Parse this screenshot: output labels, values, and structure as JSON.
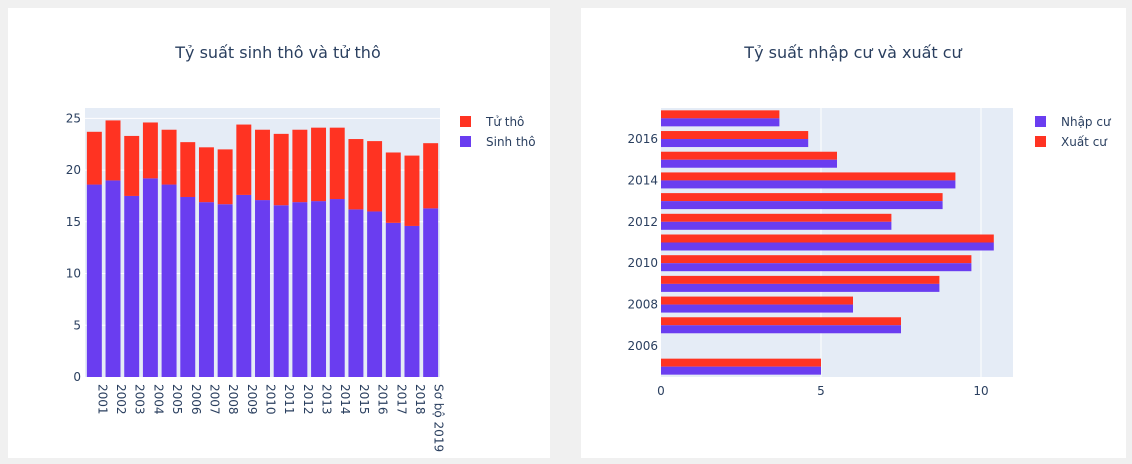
{
  "chart_data": [
    {
      "type": "bar",
      "orientation": "vertical",
      "stacked": true,
      "title": "Tỷ suất sinh thô và tử thô",
      "xlabel": "",
      "ylabel": "",
      "categories": [
        "2001",
        "2002",
        "2003",
        "2004",
        "2005",
        "2006",
        "2007",
        "2008",
        "2009",
        "2010",
        "2011",
        "2012",
        "2013",
        "2014",
        "2015",
        "2016",
        "2017",
        "2018",
        "Sơ bộ 2019"
      ],
      "series": [
        {
          "name": "Sinh thô",
          "color": "#6a3df0",
          "values": [
            18.6,
            19.0,
            17.5,
            19.2,
            18.6,
            17.4,
            16.9,
            16.7,
            17.6,
            17.1,
            16.6,
            16.9,
            17.0,
            17.2,
            16.2,
            16.0,
            14.9,
            14.6,
            16.3
          ]
        },
        {
          "name": "Tử thô",
          "color": "#ff3322",
          "values": [
            5.1,
            5.8,
            5.8,
            5.4,
            5.3,
            5.3,
            5.3,
            5.3,
            6.8,
            6.8,
            6.9,
            7.0,
            7.1,
            6.9,
            6.8,
            6.8,
            6.8,
            6.8,
            6.3
          ]
        }
      ],
      "ylim": [
        0,
        26
      ],
      "yticks": [
        0,
        5,
        10,
        15,
        20,
        25
      ],
      "grid": true,
      "legend": [
        "Tử thô",
        "Sinh thô"
      ],
      "legend_position": "right"
    },
    {
      "type": "bar",
      "orientation": "horizontal",
      "stacked": false,
      "title": "Tỷ suất nhập cư và xuất cư",
      "xlabel": "",
      "ylabel": "",
      "categories": [
        "2005",
        "2006",
        "2007",
        "2008",
        "2009",
        "2010",
        "2011",
        "2012",
        "2013",
        "2014",
        "2015",
        "2016",
        "2017"
      ],
      "ytick_labels": [
        "2006",
        "2008",
        "2010",
        "2012",
        "2014",
        "2016"
      ],
      "series": [
        {
          "name": "Nhập cư",
          "color": "#6a3df0",
          "values": [
            5.0,
            null,
            7.5,
            6.0,
            8.7,
            9.7,
            10.4,
            7.2,
            8.8,
            9.2,
            5.5,
            4.6,
            3.7
          ]
        },
        {
          "name": "Xuất cư",
          "color": "#ff3322",
          "values": [
            5.0,
            null,
            7.5,
            6.0,
            8.7,
            9.7,
            10.4,
            7.2,
            8.8,
            9.2,
            5.5,
            4.6,
            3.7
          ]
        }
      ],
      "xlim": [
        0,
        11
      ],
      "xticks": [
        0,
        5,
        10
      ],
      "grid": true,
      "legend": [
        "Nhập cư",
        "Xuất cư"
      ],
      "legend_position": "right"
    }
  ]
}
